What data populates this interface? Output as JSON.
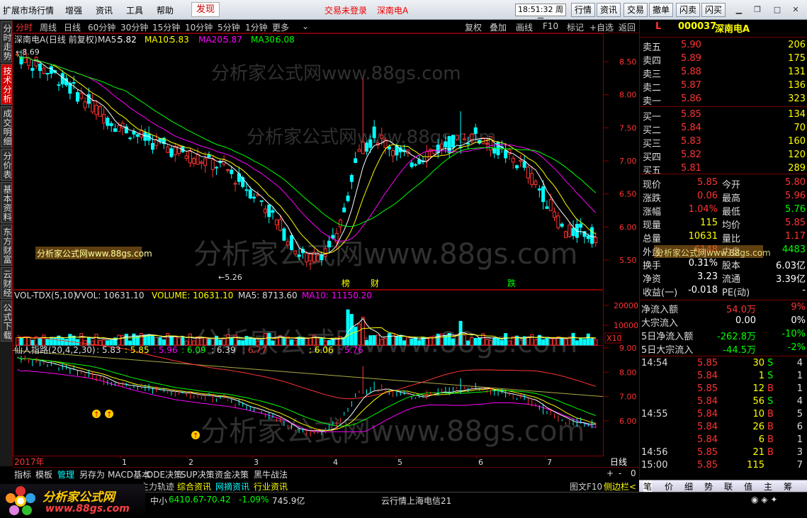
{
  "menu": {
    "items": [
      "扩展市场行情",
      "增强",
      "资讯",
      "工具",
      "帮助"
    ],
    "discover": "发现",
    "login_status": "交易未登录",
    "stock_link": "深南电A",
    "clock": "18:51:32 周三",
    "buttons": [
      "行情",
      "资讯",
      "交易",
      "撤单",
      "闪卖",
      "闪买"
    ]
  },
  "left_tabs": [
    "分时走势",
    "技术分析",
    "成交明细",
    "分价表",
    "基本资料",
    "东方财富",
    "云财经",
    "公式下载"
  ],
  "toolbar": {
    "periods": [
      "分时",
      "周线",
      "日线",
      "60分钟",
      "30分钟",
      "15分钟",
      "10分钟",
      "5分钟",
      "1分钟",
      "更多"
    ],
    "active": "日线",
    "right": [
      "复权",
      "叠加",
      "画线",
      "F10",
      "标记",
      "+自选",
      "返回"
    ]
  },
  "main_legend": {
    "name": "深南电A(日线 前复权)",
    "ma5_label": "MA5:",
    "ma5": "5.82",
    "ma10_label": "MA10:",
    "ma10": "5.83",
    "ma20_label": "MA20:",
    "ma20": "5.87",
    "ma30_label": "MA30:",
    "ma30": "6.08"
  },
  "colors": {
    "up": "#ff3333",
    "down": "#00ffff",
    "ma5": "#ffffff",
    "ma10": "#ffff00",
    "ma20": "#ff00ff",
    "ma30": "#00ff00"
  },
  "main_axis": [
    "8.50",
    "8.00",
    "7.50",
    "7.00",
    "6.50",
    "6.00",
    "5.50"
  ],
  "annotations": {
    "high": "8.69",
    "low": "5.26",
    "bang": "榜",
    "cai": "财",
    "die": "跌"
  },
  "watermark": "分析家公式网www.88gs.com",
  "watermark_small": "分析家公式网www.88gs.com",
  "vol_legend": {
    "name": "VOL-TDX(5,10)",
    "vvol": "VVOL: 10631.10",
    "volume": "VOLUME: 10631.10",
    "ma5": "MA5: 8713.60",
    "ma10": "MA10: 11150.20"
  },
  "vol_axis": [
    "20000",
    "10000"
  ],
  "vol_unit": "X10",
  "xian_legend": {
    "name": "仙人指路(20,4,2,30)",
    "v1": ": 5.83",
    ":v2": "",
    "v2": ": 5.85",
    "v3": ": 5.96",
    "v4": ": 6.09",
    "v5": ": 6.39",
    "v6": ": 6.77",
    "v7": ": 6.06",
    "v8": ": 5.76"
  },
  "xian_axis": [
    "9.00",
    "8.00",
    "7.00",
    "6.00"
  ],
  "x_axis": {
    "year": "2017年",
    "months": [
      "1",
      "2",
      "3",
      "4",
      "5",
      "6",
      "7"
    ],
    "period": "日线"
  },
  "zoom": [
    "+",
    "-",
    "0"
  ],
  "bottom_tabs": [
    "指标",
    "模板",
    "管理",
    "另存为",
    "MACD基本",
    "DDE决策",
    "SUP决策",
    "资金决策",
    "黑牛战法"
  ],
  "bottom_tabs2": [
    "主力轨迹",
    "综合资讯",
    "网摘资讯",
    "行业资讯"
  ],
  "bottom_right": {
    "f10": "图文F10",
    "side": "侧边栏<"
  },
  "quote": {
    "flag": "L",
    "code": "000037",
    "name": "深南电A",
    "sells": [
      {
        "label": "卖五",
        "price": "5.90",
        "vol": "206"
      },
      {
        "label": "卖四",
        "price": "5.89",
        "vol": "175"
      },
      {
        "label": "卖三",
        "price": "5.88",
        "vol": "131"
      },
      {
        "label": "卖二",
        "price": "5.87",
        "vol": "136"
      },
      {
        "label": "卖一",
        "price": "5.86",
        "vol": "323"
      }
    ],
    "buys": [
      {
        "label": "买一",
        "price": "5.85",
        "vol": "134"
      },
      {
        "label": "买二",
        "price": "5.84",
        "vol": "70"
      },
      {
        "label": "买三",
        "price": "5.83",
        "vol": "160"
      },
      {
        "label": "买四",
        "price": "5.82",
        "vol": "120"
      },
      {
        "label": "买五",
        "price": "5.81",
        "vol": "289"
      }
    ],
    "stats": [
      [
        "现价",
        "5.85",
        "今开",
        "5.80"
      ],
      [
        "涨跌",
        "0.06",
        "最高",
        "5.96"
      ],
      [
        "涨幅",
        "1.04%",
        "最低",
        "5.76"
      ],
      [
        "现量",
        "115",
        "均价",
        "5.85"
      ],
      [
        "总量",
        "10631",
        "量比",
        "1.17"
      ],
      [
        "外盘",
        "6148",
        "内盘",
        "4483"
      ],
      [
        "换手",
        "0.31%",
        "股本",
        "6.03亿"
      ],
      [
        "净资",
        "3.23",
        "流通",
        "3.39亿"
      ],
      [
        "收益(一)",
        "-0.018",
        "PE(动)",
        "-"
      ]
    ],
    "flows": [
      [
        "净流入额",
        "54.0万",
        "9%"
      ],
      [
        "大宗流入",
        "0.00",
        "0%"
      ],
      [
        "5日净流入额",
        "-262.8万",
        "-10%"
      ],
      [
        "5日大宗流入",
        "-44.5万",
        "-2%"
      ]
    ],
    "ticks": [
      [
        "14:54",
        "5.85",
        "30",
        "S",
        "4"
      ],
      [
        "",
        "5.84",
        "1",
        "S",
        "1"
      ],
      [
        "",
        "5.85",
        "12",
        "B",
        "1"
      ],
      [
        "",
        "5.84",
        "56",
        "S",
        "4"
      ],
      [
        "14:55",
        "5.84",
        "10",
        "B",
        "5"
      ],
      [
        "",
        "5.84",
        "26",
        "B",
        "6"
      ],
      [
        "",
        "5.84",
        "6",
        "B",
        "1"
      ],
      [
        "14:56",
        "5.85",
        "21",
        "B",
        "3"
      ],
      [
        "15:00",
        "5.85",
        "115",
        "",
        "7"
      ]
    ]
  },
  "right_tabs": [
    "笔",
    "价",
    "细",
    "势",
    "联",
    "值",
    "主",
    "筹"
  ],
  "status": {
    "index_name": "中小",
    "index_val": "6410.67",
    "index_chg": "-70.42",
    "index_pct": "-1.09%",
    "amount": "745.9亿",
    "msg": "云行情上海电信21"
  },
  "logo": {
    "text": "分析家公式网",
    "url": "www.88gs.com"
  }
}
